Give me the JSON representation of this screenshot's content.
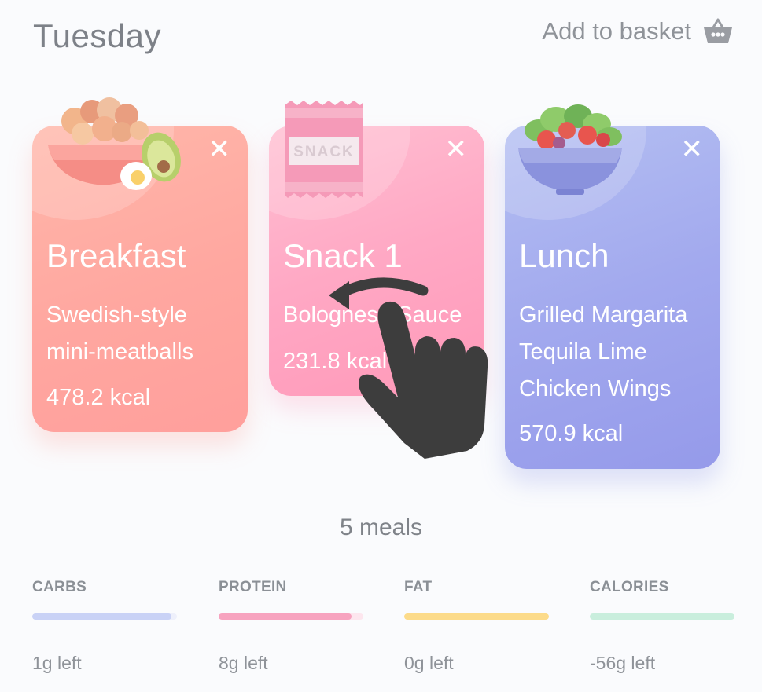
{
  "header": {
    "day": "Tuesday",
    "basket_label": "Add to basket"
  },
  "meals": [
    {
      "name": "Breakfast",
      "dish_lines": [
        "Swedish-style",
        "mini-meatballs"
      ],
      "kcal": "478.2 kcal",
      "close": "✕",
      "food_icon": "bowl-nuts-egg-avocado-icon",
      "color": "#ffa7a0"
    },
    {
      "name": "Snack 1",
      "dish_lines": [
        "Bolognese Sauce"
      ],
      "kcal": "231.8 kcal",
      "close": "✕",
      "food_icon": "snack-bag-icon",
      "snack_text": "SNACK",
      "color": "#ffa8c4"
    },
    {
      "name": "Lunch",
      "dish_lines": [
        "Grilled Margarita",
        "Tequila Lime",
        "Chicken Wings"
      ],
      "kcal": "570.9 kcal",
      "close": "✕",
      "food_icon": "salad-bowl-icon",
      "color": "#a2a9ee"
    }
  ],
  "swipe_hint_icon": "swipe-hand-icon",
  "meal_count": "5 meals",
  "macros": [
    {
      "label": "CARBS",
      "left": "1g left",
      "progress": 0.96,
      "color": "#c9d2f6",
      "track": "#eef0fb"
    },
    {
      "label": "PROTEIN",
      "left": "8g left",
      "progress": 0.92,
      "color": "#f7a3bf",
      "track": "#fde6ee"
    },
    {
      "label": "FAT",
      "left": "0g left",
      "progress": 1.0,
      "color": "#fcdb8a",
      "track": "#fdf0cf"
    },
    {
      "label": "CALORIES",
      "left": "-56g left",
      "progress": 1.0,
      "color": "#c9eedd",
      "track": "#e6f7ef"
    }
  ]
}
